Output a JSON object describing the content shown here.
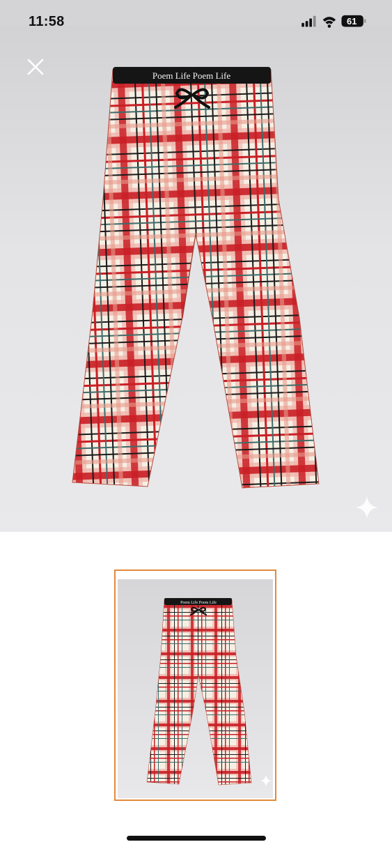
{
  "status_bar": {
    "time": "11:58",
    "battery": "61"
  },
  "viewer": {
    "close_icon": "close-icon",
    "image": {
      "waistband_text": "Poem Life   Poem Life",
      "plaid_colors": [
        "#c91f26",
        "#f0b7ae",
        "#f6efe4",
        "#1a1a1a",
        "#3e6b6a"
      ]
    },
    "sparkle_icon": "sparkle-icon"
  },
  "thumbnail": {
    "selected": true,
    "waistband_text": "Poem Life   Poem Life",
    "border_color": "#e3893a"
  }
}
